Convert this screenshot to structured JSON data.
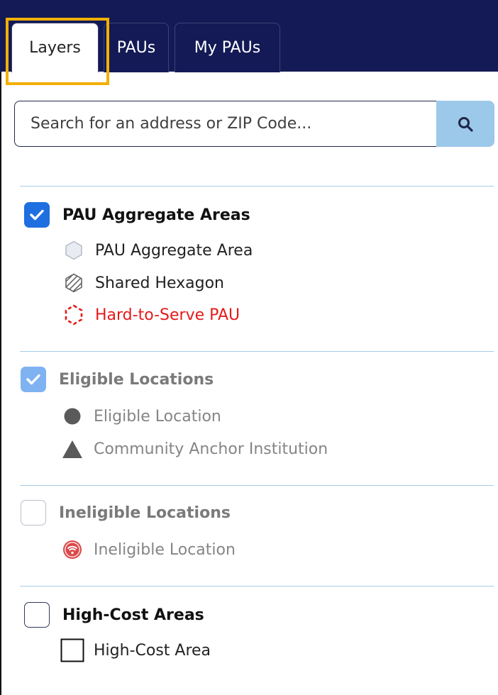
{
  "tabs": [
    {
      "label": "Layers"
    },
    {
      "label": "PAUs"
    },
    {
      "label": "My PAUs"
    }
  ],
  "search": {
    "placeholder": "Search for an address or ZIP Code...",
    "button_icon": "search-icon"
  },
  "sections": [
    {
      "title": "PAU Aggregate Areas",
      "checked": true,
      "dimmed": false,
      "legend": [
        {
          "label": "PAU Aggregate Area",
          "icon": "hexagon-icon"
        },
        {
          "label": "Shared Hexagon",
          "icon": "striped-hexagon-icon"
        },
        {
          "label": "Hard-to-Serve PAU",
          "icon": "dashed-hexagon-icon",
          "color": "#e51a1a"
        }
      ]
    },
    {
      "title": "Eligible Locations",
      "checked": true,
      "dimmed": true,
      "legend": [
        {
          "label": "Eligible Location",
          "icon": "circle-icon"
        },
        {
          "label": "Community Anchor Institution",
          "icon": "triangle-icon"
        }
      ]
    },
    {
      "title": "Ineligible Locations",
      "checked": false,
      "dimmed": true,
      "legend": [
        {
          "label": "Ineligible Location",
          "icon": "wifi-circle-icon"
        }
      ]
    },
    {
      "title": "High-Cost Areas",
      "checked": false,
      "dimmed": false,
      "legend": [
        {
          "label": "High-Cost Area",
          "icon": "square-outline-icon"
        }
      ]
    }
  ],
  "colors": {
    "header_bg": "#141a55",
    "highlight": "#f3b000",
    "checkbox_checked": "#1f6fe0",
    "search_button": "#9cc8ea",
    "hard_to_serve": "#e51a1a"
  }
}
